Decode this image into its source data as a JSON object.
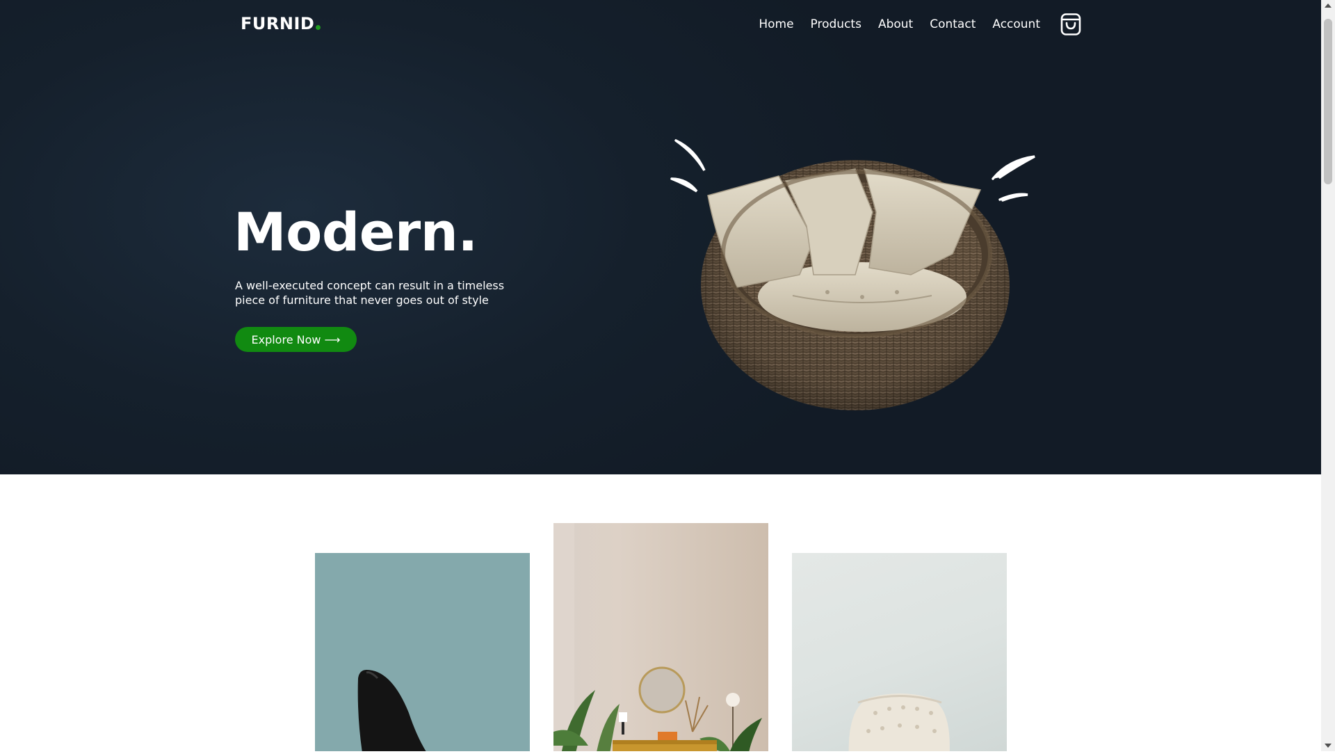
{
  "brand": {
    "name": "FURNID",
    "accent_color": "#1f9a1f"
  },
  "nav": {
    "items": [
      {
        "label": "Home"
      },
      {
        "label": "Products"
      },
      {
        "label": "About"
      },
      {
        "label": "Contact"
      },
      {
        "label": "Account"
      }
    ],
    "cart_icon": "shopping-bag-icon"
  },
  "hero": {
    "title": "Modern.",
    "description": "A well-executed concept can result in a timeless piece of furniture that never goes out of style",
    "cta_label": "Explore Now ⟶",
    "cta_color": "#118a11",
    "background_color": "#15202c",
    "image": "wicker-egg-chair-with-cushions"
  },
  "gallery": {
    "cards": [
      {
        "image": "black-chair-on-teal",
        "background": "#84a9ac"
      },
      {
        "image": "living-room-with-plants-and-mirror",
        "background": "#d9d0c8"
      },
      {
        "image": "cream-tufted-armchair",
        "background": "#e4e8e6"
      }
    ]
  },
  "scrollbar": {
    "track_color": "#f1f1f1",
    "thumb_color": "#c1c1c1"
  }
}
